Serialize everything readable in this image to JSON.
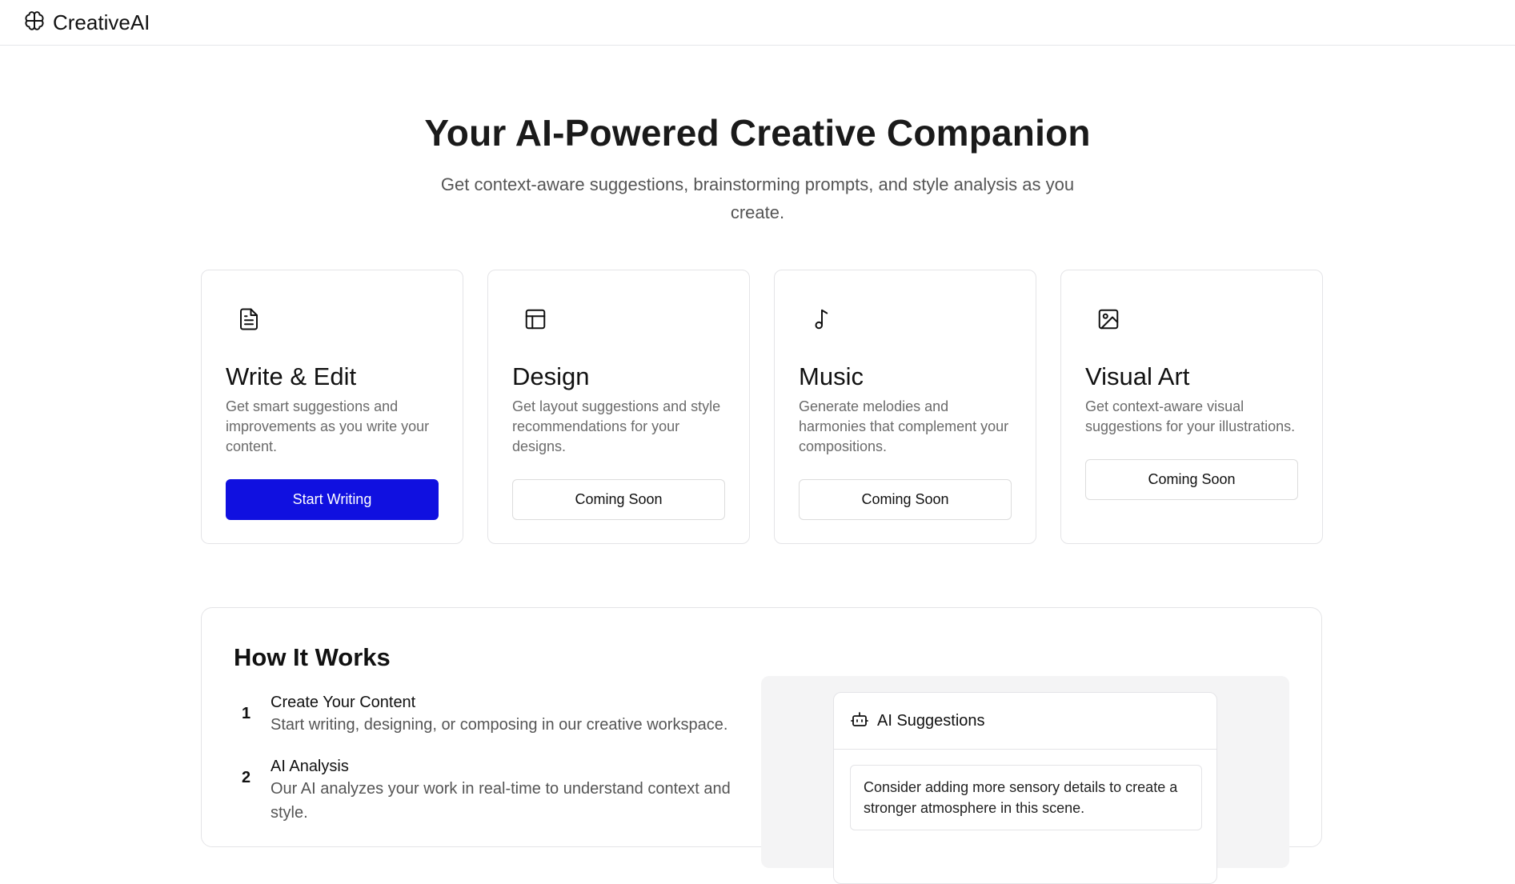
{
  "app": {
    "name": "CreativeAI",
    "logo_icon": "brain-icon"
  },
  "hero": {
    "title": "Your AI-Powered Creative Companion",
    "subtitle": "Get context-aware suggestions, brainstorming prompts, and style analysis as you create."
  },
  "cards": [
    {
      "icon": "document-icon",
      "title": "Write & Edit",
      "description": "Get smart suggestions and improvements as you write your content.",
      "button": "Start Writing",
      "button_style": "primary"
    },
    {
      "icon": "layout-icon",
      "title": "Design",
      "description": "Get layout suggestions and style recommendations for your designs.",
      "button": "Coming Soon",
      "button_style": "secondary"
    },
    {
      "icon": "music-note-icon",
      "title": "Music",
      "description": "Generate melodies and harmonies that complement your compositions.",
      "button": "Coming Soon",
      "button_style": "secondary"
    },
    {
      "icon": "image-icon",
      "title": "Visual Art",
      "description": "Get context-aware visual suggestions for your illustrations.",
      "button": "Coming Soon",
      "button_style": "secondary"
    }
  ],
  "how_it_works": {
    "title": "How It Works",
    "steps": [
      {
        "number": "1",
        "title": "Create Your Content",
        "description": "Start writing, designing, or composing in our creative workspace."
      },
      {
        "number": "2",
        "title": "AI Analysis",
        "description": "Our AI analyzes your work in real-time to understand context and style."
      }
    ],
    "suggestions_panel": {
      "icon": "bot-icon",
      "title": "AI Suggestions",
      "items": [
        "Consider adding more sensory details to create a stronger atmosphere in this scene."
      ]
    }
  },
  "colors": {
    "primary": "#1010e0",
    "border": "#e4e4e7",
    "muted_text": "#6b6b6b"
  }
}
